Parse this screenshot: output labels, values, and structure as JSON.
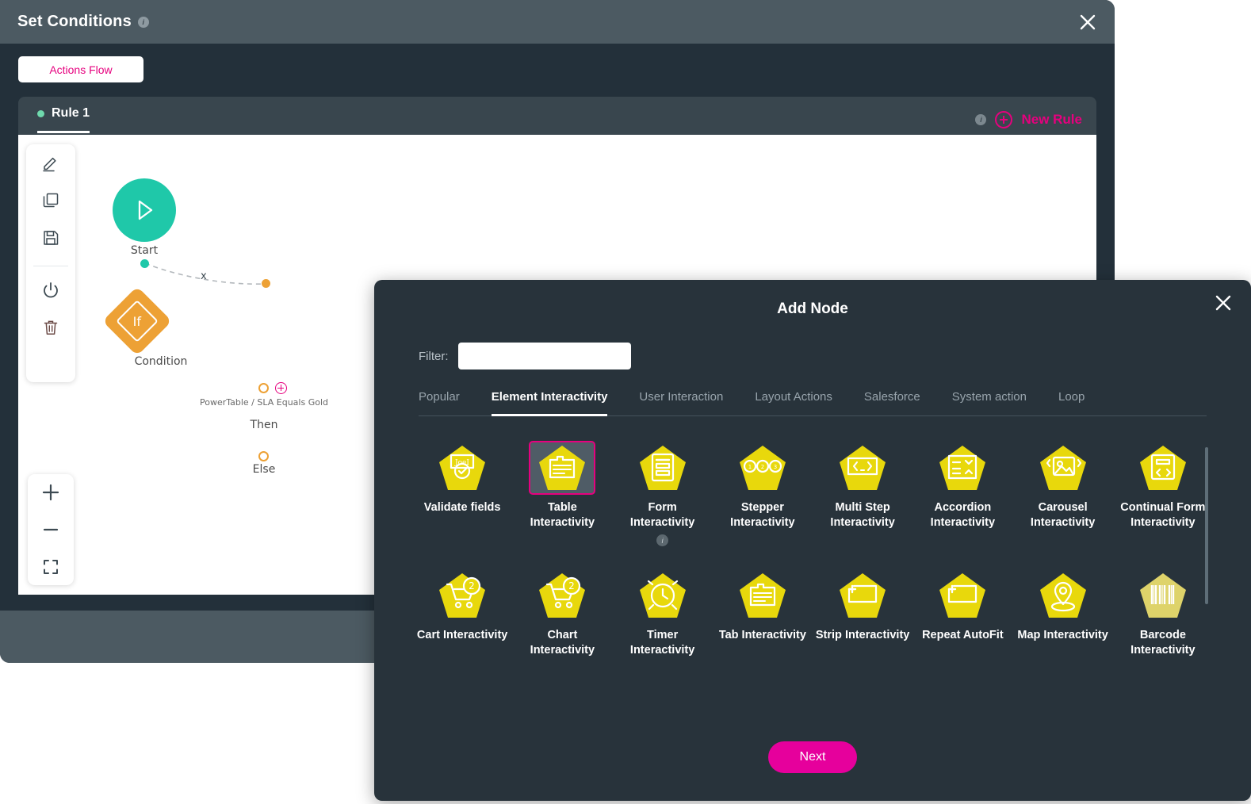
{
  "background_window": {
    "title": "Set Conditions",
    "title_info_glyph": "i",
    "close_icon": "close-icon",
    "flow_tab_label": "Actions Flow",
    "rule_tab_label": "Rule 1",
    "new_rule_label": "New Rule",
    "new_rule_info_glyph": "i",
    "toolbar_icons": [
      "edit-icon",
      "copy-icon",
      "save-icon",
      "power-icon",
      "delete-icon"
    ],
    "zoom_icons": [
      "zoom-in-icon",
      "zoom-out-icon",
      "fit-screen-icon"
    ],
    "flow": {
      "start_label": "Start",
      "edge_label": "x",
      "condition_label": "Condition",
      "condition_glyph": "If",
      "then_condition_text": "PowerTable / SLA\nEquals Gold",
      "then_label": "Then",
      "else_label": "Else"
    },
    "colors": {
      "header_bg": "#4c5a62",
      "body_bg": "#23303a",
      "panel_bg": "#39464e",
      "accent_pink": "#e6007e",
      "start_teal": "#1fc8a9",
      "condition_orange": "#eda135"
    }
  },
  "modal": {
    "title": "Add Node",
    "close_icon": "close-icon",
    "filter": {
      "label": "Filter:",
      "value": "",
      "placeholder": ""
    },
    "tabs": [
      {
        "label": "Popular",
        "active": false
      },
      {
        "label": "Element Interactivity",
        "active": true
      },
      {
        "label": "User Interaction",
        "active": false
      },
      {
        "label": "Layout Actions",
        "active": false
      },
      {
        "label": "Salesforce",
        "active": false
      },
      {
        "label": "System action",
        "active": false
      },
      {
        "label": "Loop",
        "active": false
      }
    ],
    "nodes": [
      {
        "label": "Validate fields",
        "icon": "validate-fields-icon",
        "selected": false,
        "info": false
      },
      {
        "label": "Table Interactivity",
        "icon": "table-icon",
        "selected": true,
        "info": false
      },
      {
        "label": "Form Interactivity",
        "icon": "form-icon",
        "selected": false,
        "info": true
      },
      {
        "label": "Stepper Interactivity",
        "icon": "stepper-icon",
        "selected": false,
        "info": false
      },
      {
        "label": "Multi Step Interactivity",
        "icon": "code-brackets-icon",
        "selected": false,
        "info": false
      },
      {
        "label": "Accordion Interactivity",
        "icon": "accordion-icon",
        "selected": false,
        "info": false
      },
      {
        "label": "Carousel Interactivity",
        "icon": "carousel-image-icon",
        "selected": false,
        "info": false
      },
      {
        "label": "Continual Form Interactivity",
        "icon": "continual-form-icon",
        "selected": false,
        "info": false
      },
      {
        "label": "Cart Interactivity",
        "icon": "cart-badge-icon",
        "selected": false,
        "info": false
      },
      {
        "label": "Chart Interactivity",
        "icon": "cart-badge-icon",
        "selected": false,
        "info": false
      },
      {
        "label": "Timer Interactivity",
        "icon": "timer-clock-icon",
        "selected": false,
        "info": false
      },
      {
        "label": "Tab Interactivity",
        "icon": "tab-folder-icon",
        "selected": false,
        "info": false
      },
      {
        "label": "Strip Interactivity",
        "icon": "strip-plus-icon",
        "selected": false,
        "info": false
      },
      {
        "label": "Repeat AutoFit",
        "icon": "repeat-autofit-icon",
        "selected": false,
        "info": false
      },
      {
        "label": "Map Interactivity",
        "icon": "map-pin-icon",
        "selected": false,
        "info": false
      },
      {
        "label": "Barcode Interactivity",
        "icon": "barcode-icon",
        "selected": false,
        "info": false
      }
    ],
    "next_label": "Next",
    "colors": {
      "modal_bg": "#28333b",
      "node_yellow": "#e8d80c",
      "node_yellow_muted": "#ded36a",
      "selected_border": "#e6007e",
      "next_bg": "#e6009c"
    }
  }
}
